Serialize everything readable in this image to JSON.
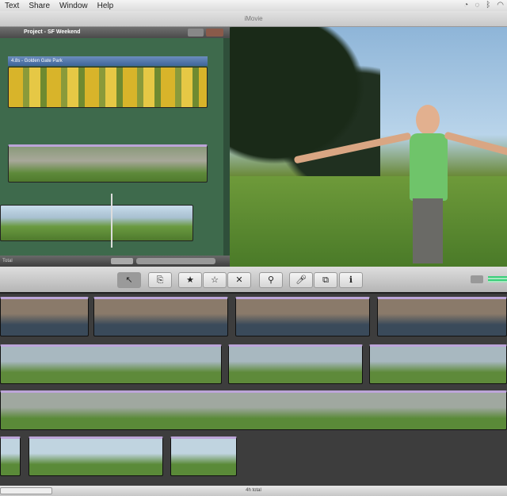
{
  "menubar": {
    "items": [
      "Text",
      "Share",
      "Window",
      "Help"
    ]
  },
  "window": {
    "title": "iMovie"
  },
  "project": {
    "title": "Project - SF Weekend",
    "clip_title": "4.8s - Golden Gate Park",
    "footer": "Total"
  },
  "toolbar": {
    "tools": [
      "pointer-icon",
      "add-clip-icon",
      "favorite-icon",
      "unmark-icon",
      "reject-icon",
      "keyword-icon",
      "voiceover-icon",
      "crop-icon",
      "info-icon"
    ]
  },
  "status": {
    "total": "4h total"
  },
  "colors": {
    "project_bg": "#3e6a4c",
    "event_bg": "#3d3d3d",
    "clip_marker": "#bca5d8"
  }
}
